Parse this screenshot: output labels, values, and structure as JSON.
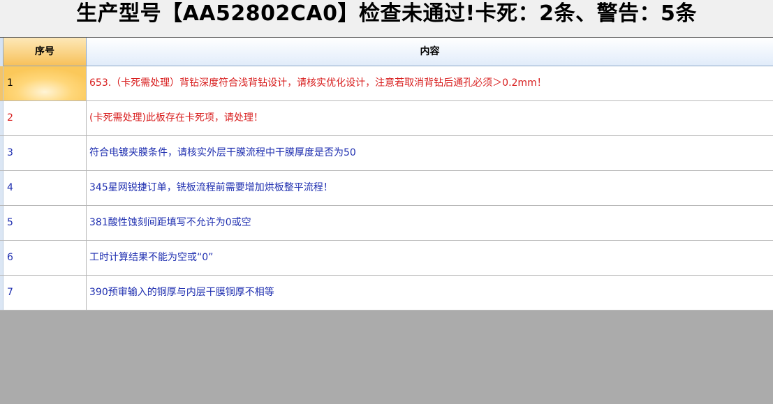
{
  "title": "生产型号【AA52802CA0】检查未通过!卡死：2条、警告：5条",
  "colors": {
    "error": "#d81e1e",
    "warning": "#1f2fb0"
  },
  "table": {
    "headers": {
      "seq": "序号",
      "content": "内容"
    },
    "rows": [
      {
        "seq": "1",
        "content": "653.（卡死需处理）背钻深度符合浅背钻设计，请核实优化设计，注意若取消背钻后通孔必须＞0.2mm！",
        "level": "error"
      },
      {
        "seq": "2",
        "content": "(卡死需处理)此板存在卡死项，请处理！",
        "level": "error"
      },
      {
        "seq": "3",
        "content": "符合电镀夹膜条件，请核实外层干膜流程中干膜厚度是否为50",
        "level": "warning"
      },
      {
        "seq": "4",
        "content": "345星网锐捷订单，铣板流程前需要增加烘板整平流程！",
        "level": "warning"
      },
      {
        "seq": "5",
        "content": "381酸性蚀刻间距填写不允许为0或空",
        "level": "warning"
      },
      {
        "seq": "6",
        "content": "工时计算结果不能为空或“0”",
        "level": "warning"
      },
      {
        "seq": "7",
        "content": "390预审输入的铜厚与内层干膜铜厚不相等",
        "level": "warning"
      }
    ]
  }
}
